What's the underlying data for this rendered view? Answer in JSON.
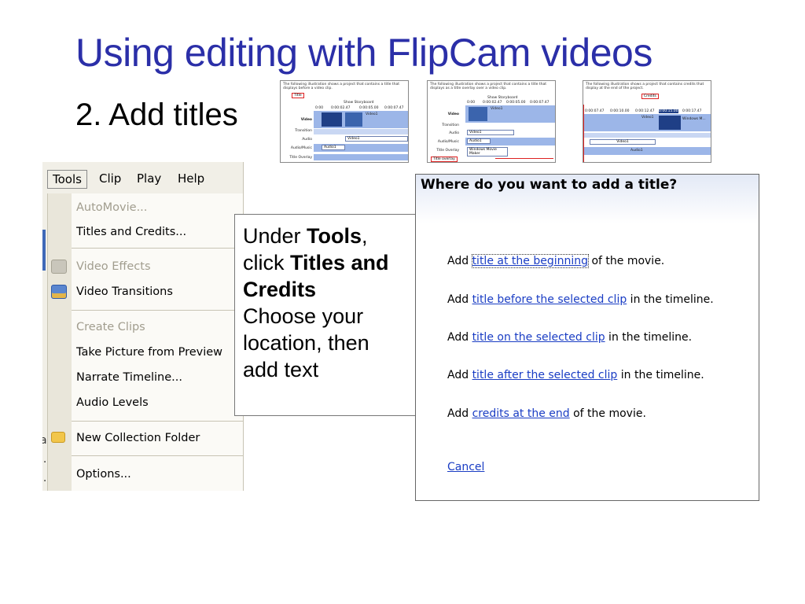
{
  "slide": {
    "title": "Using editing with FlipCam videos",
    "subtitle": "2. Add titles"
  },
  "thumbnails": [
    {
      "caption": "The following illustration shows a project that contains a title that displays before a video clip.",
      "tag": "Title",
      "toolbar": "Show Storyboard",
      "times": [
        "0:00",
        "0:00:02.47",
        "0:00:05.00",
        "0:00:07.47"
      ],
      "rows": [
        "Video",
        "Transition",
        "Audio",
        "Audio/Music",
        "Title Overlay"
      ],
      "clip_video": "Video1",
      "clip_audio": "Video1",
      "clip_music": "Audio1"
    },
    {
      "caption": "The following illustration shows a project that contains a title that displays as a title overlay over a video clip.",
      "toolbar": "Show Storyboard",
      "times": [
        "0:00",
        "0:00:02.47",
        "0:00:05.00",
        "0:00:07.47"
      ],
      "rows": [
        "Video",
        "Transition",
        "Audio",
        "Audio/Music",
        "Title Overlay"
      ],
      "clip_video": "Video1",
      "clip_audio": "Video1",
      "clip_music": "Audio1",
      "overlay": "Windows Movie Maker",
      "tag": "Title overlay"
    },
    {
      "caption": "The following illustration shows a project that contains credits that display at the end of the project.",
      "tag": "Credits",
      "times": [
        "0:00:07.47",
        "0:00:10.00",
        "0:00:12.47",
        "0:00:15.00",
        "0:00:17.47"
      ],
      "clip_video": "Video1",
      "clip_title": "Windows M...",
      "clip_audio": "Video1",
      "clip_music": "Audio1"
    }
  ],
  "menu": {
    "bar": [
      "Tools",
      "Clip",
      "Play",
      "Help"
    ],
    "items": [
      {
        "label": "AutoMovie...",
        "disabled": true
      },
      {
        "label": "Titles and Credits...",
        "disabled": false
      },
      {
        "label": "Video Effects",
        "disabled": true
      },
      {
        "label": "Video Transitions",
        "disabled": false
      },
      {
        "label": "Create Clips",
        "disabled": true
      },
      {
        "label": "Take Picture from Preview",
        "disabled": false
      },
      {
        "label": "Narrate Timeline...",
        "disabled": false
      },
      {
        "label": "Audio Levels",
        "disabled": false
      },
      {
        "label": "New Collection Folder",
        "disabled": false
      },
      {
        "label": "Options...",
        "disabled": false
      }
    ],
    "icons": [
      "video-effects-icon",
      "video-transitions-icon",
      "new-folder-icon"
    ],
    "edge_marks": [
      "a",
      "l.",
      "l."
    ]
  },
  "callout": {
    "t1": "Under ",
    "t2": "Tools",
    "t3": ",",
    "t4": "click ",
    "t5": "Titles and Credits",
    "t6": "Choose your location, then add text"
  },
  "dialog": {
    "title": "Where do you want to add a title?",
    "options": [
      {
        "pre": "Add ",
        "link": "title at the beginning",
        "post": " of the movie."
      },
      {
        "pre": "Add ",
        "link": "title before the selected clip",
        "post": " in the timeline."
      },
      {
        "pre": "Add ",
        "link": "title on the selected clip",
        "post": " in the timeline."
      },
      {
        "pre": "Add ",
        "link": "title after the selected clip",
        "post": " in the timeline."
      },
      {
        "pre": "Add ",
        "link": "credits at the end",
        "post": " of the movie."
      }
    ],
    "cancel": "Cancel"
  },
  "colors": {
    "title": "#2b2fa8",
    "link": "#1a3dc4",
    "timeline_band": "#9cb6e8",
    "clip_dark": "#1f3f86"
  }
}
